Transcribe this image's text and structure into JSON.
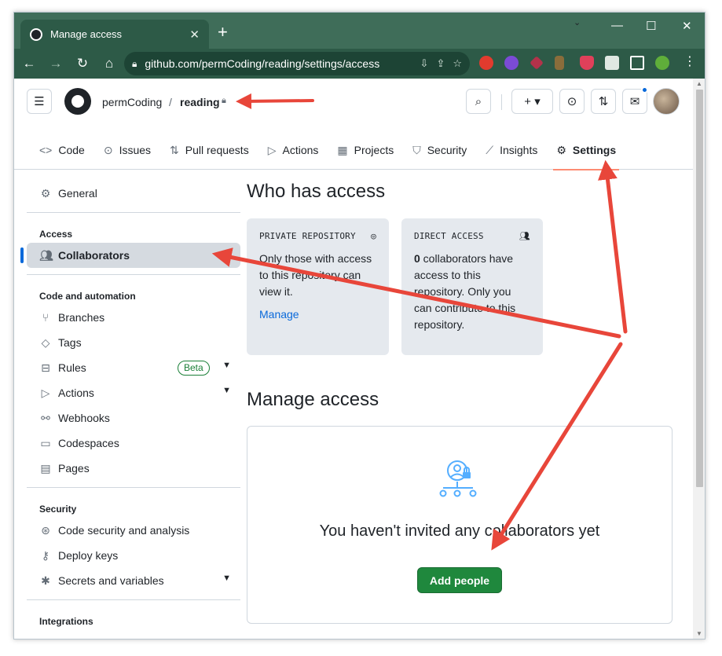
{
  "browser": {
    "tab_title": "Manage access",
    "tab_close": "✕",
    "new_tab": "+",
    "url": "github.com/permCoding/reading/settings/access",
    "win_min": "—",
    "win_max": "☐",
    "win_close": "✕",
    "tab_search": "⌄"
  },
  "header": {
    "owner": "permCoding",
    "separator": "/",
    "repo": "reading"
  },
  "repo_nav": [
    {
      "label": "Code",
      "icon": "<>"
    },
    {
      "label": "Issues",
      "icon": "⊙"
    },
    {
      "label": "Pull requests",
      "icon": "⇅"
    },
    {
      "label": "Actions",
      "icon": "▷"
    },
    {
      "label": "Projects",
      "icon": "▦"
    },
    {
      "label": "Security",
      "icon": "⛉"
    },
    {
      "label": "Insights",
      "icon": "⟋"
    },
    {
      "label": "Settings",
      "icon": "⚙"
    }
  ],
  "sidebar": {
    "general": "General",
    "access_head": "Access",
    "collaborators": "Collaborators",
    "automation_head": "Code and automation",
    "branches": "Branches",
    "tags": "Tags",
    "rules": "Rules",
    "rules_badge": "Beta",
    "actions": "Actions",
    "webhooks": "Webhooks",
    "codespaces": "Codespaces",
    "pages": "Pages",
    "security_head": "Security",
    "code_security": "Code security and analysis",
    "deploy_keys": "Deploy keys",
    "secrets": "Secrets and variables",
    "integrations_head": "Integrations"
  },
  "main": {
    "who_title": "Who has access",
    "private_card": {
      "heading": "PRIVATE REPOSITORY",
      "body": "Only those with access to this repository can view it.",
      "link": "Manage"
    },
    "direct_card": {
      "heading": "DIRECT ACCESS",
      "count": "0",
      "body": " collaborators have access to this repository. Only you can contribute to this repository."
    },
    "manage_title": "Manage access",
    "empty_text": "You haven't invited any collaborators yet",
    "add_button": "Add people"
  },
  "colors": {
    "accent_green": "#1f883d",
    "arrow_red": "#e8463a",
    "chrome_green": "#2d5a47",
    "active_blue": "#0969da"
  }
}
